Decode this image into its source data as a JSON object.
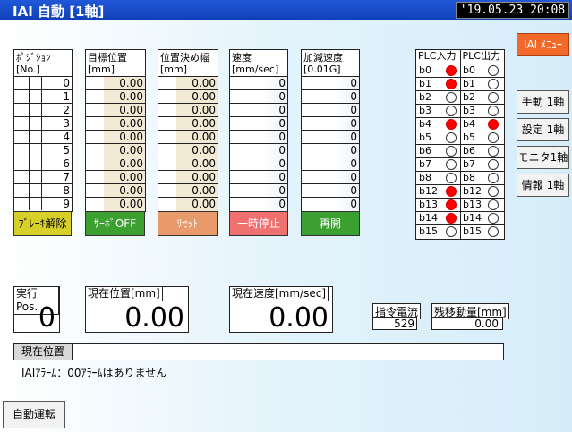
{
  "title": "IAI 自動 [1軸]",
  "datetime": "'19.05.23 20:08",
  "position_table": {
    "headers": {
      "position": "ﾎﾟｼﾞｼｮﾝ\n[No.]",
      "target": "目標位置\n[mm]",
      "positioning_width": "位置決め幅\n[mm]",
      "speed": "速度\n[mm/sec]",
      "accel": "加減速度\n[0.01G]"
    },
    "rows": [
      {
        "no": "0",
        "target": "0.00",
        "width": "0.00",
        "speed": "0",
        "accel": "0"
      },
      {
        "no": "1",
        "target": "0.00",
        "width": "0.00",
        "speed": "0",
        "accel": "0"
      },
      {
        "no": "2",
        "target": "0.00",
        "width": "0.00",
        "speed": "0",
        "accel": "0"
      },
      {
        "no": "3",
        "target": "0.00",
        "width": "0.00",
        "speed": "0",
        "accel": "0"
      },
      {
        "no": "4",
        "target": "0.00",
        "width": "0.00",
        "speed": "0",
        "accel": "0"
      },
      {
        "no": "5",
        "target": "0.00",
        "width": "0.00",
        "speed": "0",
        "accel": "0"
      },
      {
        "no": "6",
        "target": "0.00",
        "width": "0.00",
        "speed": "0",
        "accel": "0"
      },
      {
        "no": "7",
        "target": "0.00",
        "width": "0.00",
        "speed": "0",
        "accel": "0"
      },
      {
        "no": "8",
        "target": "0.00",
        "width": "0.00",
        "speed": "0",
        "accel": "0"
      },
      {
        "no": "9",
        "target": "0.00",
        "width": "0.00",
        "speed": "0",
        "accel": "0"
      }
    ]
  },
  "buttons": {
    "brake_release": "ﾌﾞﾚｰｷ解除",
    "servo_off": "ｻｰﾎﾞOFF",
    "reset": "ﾘｾｯﾄ",
    "pause": "一時停止",
    "resume": "再開",
    "auto_run": "自動運転"
  },
  "button_colors": {
    "brake_release": "#d7cf2a",
    "servo_off": "#3ca030",
    "reset": "#e89a6a",
    "pause": "#f07070",
    "resume": "#3ca030"
  },
  "plc": {
    "input_header": "PLC入力",
    "output_header": "PLC出力",
    "rows": [
      {
        "in_label": "b0",
        "in_on": true,
        "out_label": "b0",
        "out_on": false
      },
      {
        "in_label": "b1",
        "in_on": true,
        "out_label": "b1",
        "out_on": false
      },
      {
        "in_label": "b2",
        "in_on": false,
        "out_label": "b2",
        "out_on": false
      },
      {
        "in_label": "b3",
        "in_on": false,
        "out_label": "b3",
        "out_on": false
      },
      {
        "in_label": "b4",
        "in_on": true,
        "out_label": "b4",
        "out_on": true
      },
      {
        "in_label": "b5",
        "in_on": false,
        "out_label": "b5",
        "out_on": false
      },
      {
        "in_label": "b6",
        "in_on": false,
        "out_label": "b6",
        "out_on": false
      },
      {
        "in_label": "b7",
        "in_on": false,
        "out_label": "b7",
        "out_on": false
      },
      {
        "in_label": "b8",
        "in_on": false,
        "out_label": "b8",
        "out_on": false
      },
      {
        "in_label": "b12",
        "in_on": true,
        "out_label": "b12",
        "out_on": false
      },
      {
        "in_label": "b13",
        "in_on": true,
        "out_label": "b13",
        "out_on": false
      },
      {
        "in_label": "b14",
        "in_on": true,
        "out_label": "b14",
        "out_on": false
      },
      {
        "in_label": "b15",
        "in_on": false,
        "out_label": "b15",
        "out_on": false
      }
    ]
  },
  "side_menu": {
    "iai_menu": "IAI ﾒﾆｭｰ",
    "manual": "手動 1軸",
    "settings": "設定 1軸",
    "monitor": "モニタ1軸",
    "info": "情報 1軸"
  },
  "status": {
    "exec_pos_label": "実行Pos.",
    "exec_pos_value": "0",
    "current_pos_label": "現在位置[mm]",
    "current_pos_value": "0.00",
    "current_speed_label": "現在速度[mm/sec]",
    "current_speed_value": "0.00",
    "command_current_label": "指令電流",
    "command_current_value": "529",
    "residual_label": "残移動量[mm]",
    "residual_value": "0.00",
    "position_bar_label": "現在位置",
    "position_bar_fraction": 0.0,
    "alarm_text": "IAIｱﾗｰﾑ：00ｱﾗｰﾑはありません"
  }
}
